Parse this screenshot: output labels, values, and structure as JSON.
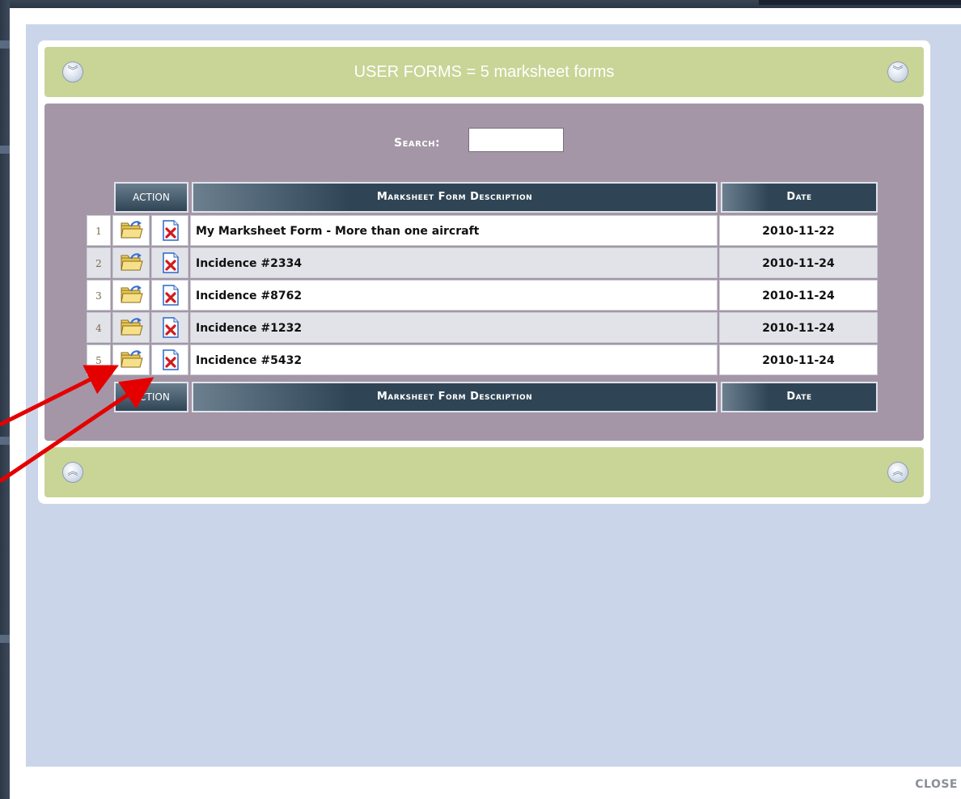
{
  "header": {
    "title": "USER FORMS  =  5 marksheet forms"
  },
  "search": {
    "label": "Search:",
    "value": ""
  },
  "table": {
    "columns": {
      "action": "ACTION",
      "description": "Marksheet Form Description",
      "date": "Date"
    },
    "rows": [
      {
        "num": "1",
        "description": "My Marksheet Form - More than one aircraft",
        "date": "2010-11-22"
      },
      {
        "num": "2",
        "description": "Incidence #2334",
        "date": "2010-11-24"
      },
      {
        "num": "3",
        "description": "Incidence #8762",
        "date": "2010-11-24"
      },
      {
        "num": "4",
        "description": "Incidence #1232",
        "date": "2010-11-24"
      },
      {
        "num": "5",
        "description": "Incidence #5432",
        "date": "2010-11-24"
      }
    ]
  },
  "footer": {
    "close_label": "CLOSE"
  },
  "colors": {
    "panel_bar": "#c9d497",
    "body_area": "#a496a7",
    "modal_inner": "#cbd5ea",
    "header_cell": "#2f4555",
    "annotation_arrow": "#e50000"
  },
  "icons": {
    "collapse": "chevron-down-circle-icon",
    "expand": "chevron-up-circle-icon",
    "open_form": "open-folder-icon",
    "delete_form": "delete-document-icon"
  }
}
